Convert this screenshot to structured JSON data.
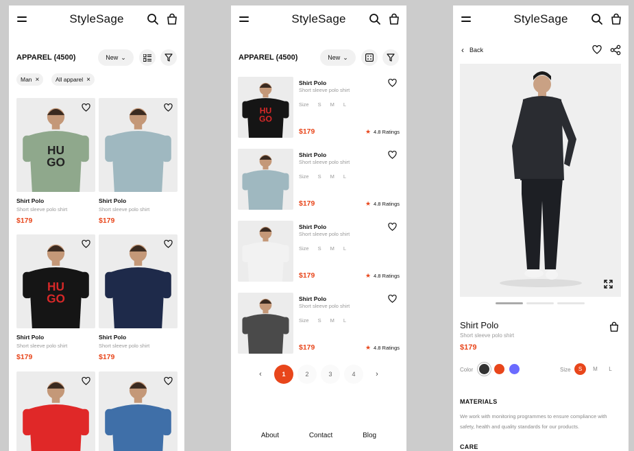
{
  "brand": "StyleSage",
  "colors": {
    "accent": "#e8461b",
    "swatches": [
      "#333333",
      "#e8461b",
      "#6b6bff"
    ]
  },
  "grid_screen": {
    "title": "APPAREL (4500)",
    "sort_label": "New",
    "chips": [
      "Man",
      "All apparel"
    ],
    "products": [
      {
        "name": "Shirt Polo",
        "subtitle": "Short sleeve polo shirt",
        "price": "$179",
        "shirt_color": "#8fa88c",
        "print": "HUGO"
      },
      {
        "name": "Shirt Polo",
        "subtitle": "Short sleeve polo shirt",
        "price": "$179",
        "shirt_color": "#9fb8c0",
        "print": ""
      },
      {
        "name": "Shirt Polo",
        "subtitle": "Short sleeve polo shirt",
        "price": "$179",
        "shirt_color": "#151515",
        "print": "HUGO"
      },
      {
        "name": "Shirt Polo",
        "subtitle": "Short sleeve polo shirt",
        "price": "$179",
        "shirt_color": "#1e2a4a",
        "print": ""
      },
      {
        "name": "",
        "subtitle": "",
        "price": "",
        "shirt_color": "#e02828",
        "print": ""
      },
      {
        "name": "",
        "subtitle": "",
        "price": "",
        "shirt_color": "#3f6fa8",
        "print": ""
      }
    ]
  },
  "list_screen": {
    "title": "APPAREL (4500)",
    "sort_label": "New",
    "items": [
      {
        "name": "Shirt Polo",
        "subtitle": "Short sleeve polo shirt",
        "size_label": "Size",
        "sizes": [
          "S",
          "M",
          "L"
        ],
        "price": "$179",
        "rating": "4.8 Ratings",
        "shirt_color": "#151515"
      },
      {
        "name": "Shirt Polo",
        "subtitle": "Short sleeve polo shirt",
        "size_label": "Size",
        "sizes": [
          "S",
          "M",
          "L"
        ],
        "price": "$179",
        "rating": "4.8 Ratings",
        "shirt_color": "#9fb8c0"
      },
      {
        "name": "Shirt Polo",
        "subtitle": "Short sleeve polo shirt",
        "size_label": "Size",
        "sizes": [
          "S",
          "M",
          "L"
        ],
        "price": "$179",
        "rating": "4.8 Ratings",
        "shirt_color": "#f2f2f2"
      },
      {
        "name": "Shirt Polo",
        "subtitle": "Short sleeve polo shirt",
        "size_label": "Size",
        "sizes": [
          "S",
          "M",
          "L"
        ],
        "price": "$179",
        "rating": "4.8 Ratings",
        "shirt_color": "#4a4a4a"
      }
    ],
    "pagination": {
      "prev": "‹",
      "pages": [
        "1",
        "2",
        "3",
        "4"
      ],
      "next": "›",
      "current": "1"
    },
    "footer": [
      "About",
      "Contact",
      "Blog"
    ]
  },
  "detail_screen": {
    "back_label": "Back",
    "name": "Shirt Polo",
    "subtitle": "Short sleeve polo shirt",
    "price": "$179",
    "color_label": "Color",
    "size_label": "Size",
    "sizes": [
      "S",
      "M",
      "L"
    ],
    "selected_size": "S",
    "materials_heading": "MATERIALS",
    "materials_text": "We work with monitoring programmes to ensure compliance with safety, health and quality standards for our products.",
    "care_heading": "CARE"
  }
}
